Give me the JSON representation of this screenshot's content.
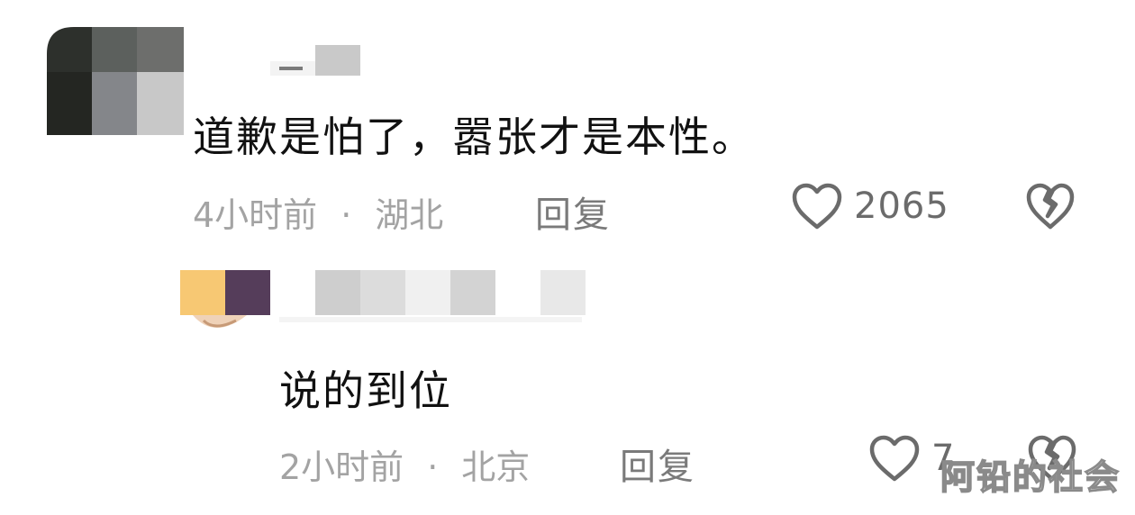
{
  "comments": [
    {
      "text": "道歉是怕了，嚣张才是本性。",
      "time": "4小时前",
      "separator": "·",
      "location": "湖北",
      "reply_label": "回复",
      "likes": "2065",
      "icons": {
        "like": "heart-outline-icon",
        "dislike": "broken-heart-icon"
      }
    },
    {
      "text": "说的到位",
      "time": "2小时前",
      "separator": "·",
      "location": "北京",
      "reply_label": "回复",
      "likes": "7",
      "icons": {
        "like": "heart-outline-icon",
        "dislike": "broken-heart-icon"
      }
    }
  ],
  "watermark": "阿铅的社会",
  "colors": {
    "text": "#111111",
    "meta": "#a3a3a3",
    "action": "#6b6b6b",
    "avatar_yellow": "#f7c873",
    "avatar_purple": "#553d5a"
  }
}
